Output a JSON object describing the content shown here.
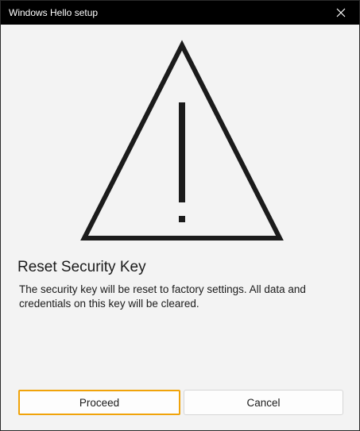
{
  "window": {
    "title": "Windows Hello setup"
  },
  "icons": {
    "close": "close-icon",
    "warning": "warning-triangle-icon"
  },
  "dialog": {
    "heading": "Reset Security Key",
    "message": "The security key will be reset to factory settings. All data and credentials on this key will be cleared."
  },
  "buttons": {
    "proceed_label": "Proceed",
    "cancel_label": "Cancel"
  },
  "colors": {
    "titlebar": "#000000",
    "focus_outline": "#f0a30a",
    "background": "#f3f3f3"
  }
}
